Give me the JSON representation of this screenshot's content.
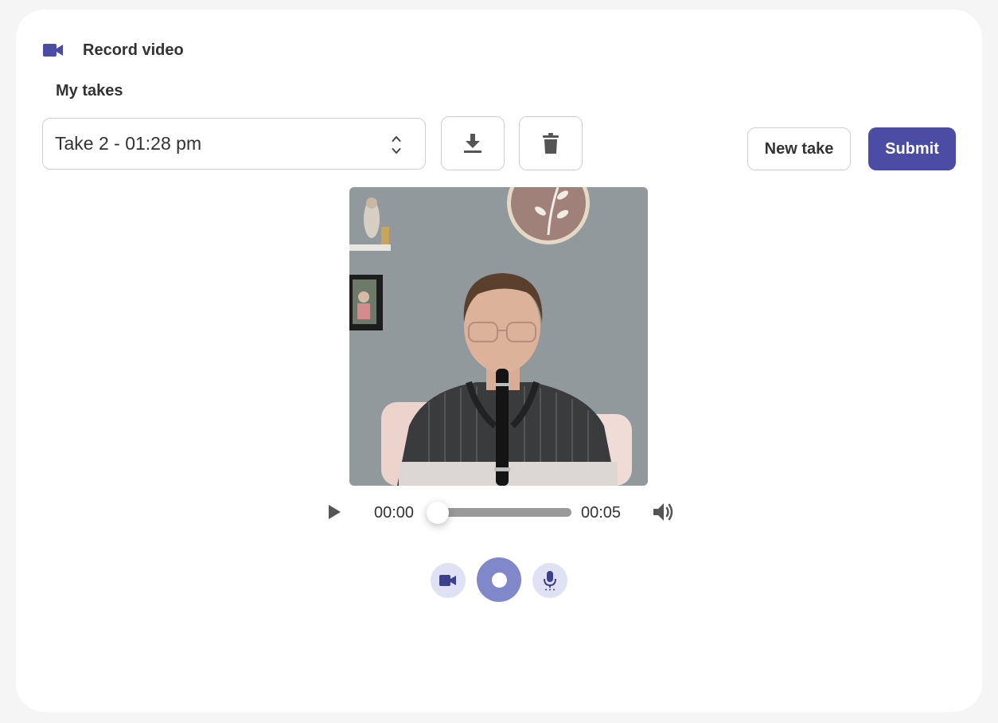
{
  "header": {
    "title": "Record video",
    "icon": "video-camera-icon"
  },
  "takes": {
    "label": "My takes",
    "selected": "Take 2 - 01:28 pm"
  },
  "actions": {
    "download_icon": "download-icon",
    "delete_icon": "trash-icon",
    "new_take": "New take",
    "submit": "Submit"
  },
  "player": {
    "current_time": "00:00",
    "duration": "00:05",
    "progress": 0
  },
  "recorder": {
    "camera_icon": "video-camera-icon",
    "record_icon": "record-icon",
    "mic_icon": "microphone-icon"
  },
  "colors": {
    "accent": "#4b4ca3",
    "record_button": "#8088c9",
    "toggle_bg": "#dfe1f4"
  }
}
